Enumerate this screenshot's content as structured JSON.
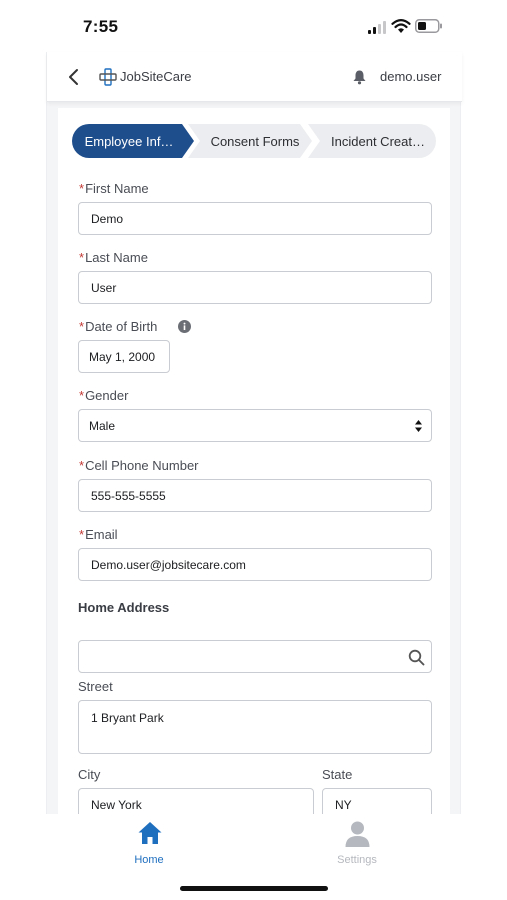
{
  "status_bar": {
    "time": "7:55"
  },
  "header": {
    "brand": "JobSiteCare",
    "user": "demo.user"
  },
  "path_steps": [
    {
      "label": "Employee Inf…",
      "active": true
    },
    {
      "label": "Consent Forms",
      "active": false
    },
    {
      "label": "Incident Creat…",
      "active": false
    }
  ],
  "form": {
    "required_marker": "*",
    "first_name": {
      "label": "First Name",
      "value": "Demo"
    },
    "last_name": {
      "label": "Last Name",
      "value": "User"
    },
    "dob": {
      "label": "Date of Birth",
      "value": "May 1, 2000"
    },
    "gender": {
      "label": "Gender",
      "value": "Male"
    },
    "cell_phone": {
      "label": "Cell Phone Number",
      "value": "555-555-5555"
    },
    "email": {
      "label": "Email",
      "value": "Demo.user@jobsitecare.com"
    },
    "home_address": {
      "title": "Home Address",
      "search_value": "",
      "street": {
        "label": "Street",
        "value": "1 Bryant Park"
      },
      "city": {
        "label": "City",
        "value": "New York"
      },
      "state": {
        "label": "State",
        "value": "NY"
      }
    }
  },
  "tabs": [
    {
      "label": "Home",
      "active": true
    },
    {
      "label": "Settings",
      "active": false
    }
  ],
  "colors": {
    "brand_blue": "#1f4e8c",
    "home_tab": "#1f6fbf",
    "required_red": "#c23934",
    "inactive_tab": "#b5b8be"
  },
  "icons": [
    "signal-icon",
    "wifi-icon",
    "battery-icon",
    "back-chevron-icon",
    "jobsitecare-logo-icon",
    "bell-icon",
    "info-icon",
    "select-arrows-icon",
    "search-icon",
    "home-icon",
    "person-icon"
  ]
}
